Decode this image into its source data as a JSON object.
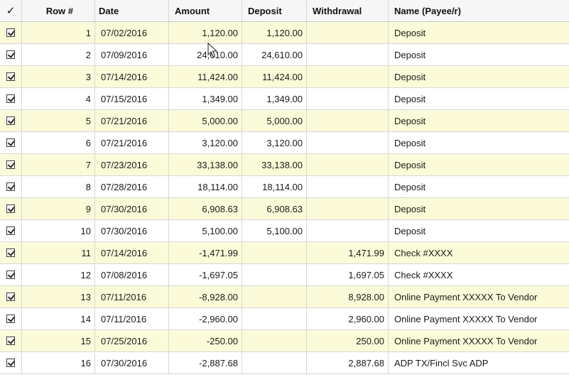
{
  "header": {
    "check": "✓",
    "row": "Row #",
    "date": "Date",
    "amount": "Amount",
    "deposit": "Deposit",
    "withdrawal": "Withdrawal",
    "name": "Name (Payee/r)"
  },
  "rows": [
    {
      "checked": true,
      "row": "1",
      "date": "07/02/2016",
      "amount": "1,120.00",
      "deposit": "1,120.00",
      "withdrawal": "",
      "name": "Deposit"
    },
    {
      "checked": true,
      "row": "2",
      "date": "07/09/2016",
      "amount": "24,610.00",
      "deposit": "24,610.00",
      "withdrawal": "",
      "name": "Deposit"
    },
    {
      "checked": true,
      "row": "3",
      "date": "07/14/2016",
      "amount": "11,424.00",
      "deposit": "11,424.00",
      "withdrawal": "",
      "name": "Deposit"
    },
    {
      "checked": true,
      "row": "4",
      "date": "07/15/2016",
      "amount": "1,349.00",
      "deposit": "1,349.00",
      "withdrawal": "",
      "name": "Deposit"
    },
    {
      "checked": true,
      "row": "5",
      "date": "07/21/2016",
      "amount": "5,000.00",
      "deposit": "5,000.00",
      "withdrawal": "",
      "name": "Deposit"
    },
    {
      "checked": true,
      "row": "6",
      "date": "07/21/2016",
      "amount": "3,120.00",
      "deposit": "3,120.00",
      "withdrawal": "",
      "name": "Deposit"
    },
    {
      "checked": true,
      "row": "7",
      "date": "07/23/2016",
      "amount": "33,138.00",
      "deposit": "33,138.00",
      "withdrawal": "",
      "name": "Deposit"
    },
    {
      "checked": true,
      "row": "8",
      "date": "07/28/2016",
      "amount": "18,114.00",
      "deposit": "18,114.00",
      "withdrawal": "",
      "name": "Deposit"
    },
    {
      "checked": true,
      "row": "9",
      "date": "07/30/2016",
      "amount": "6,908.63",
      "deposit": "6,908.63",
      "withdrawal": "",
      "name": "Deposit"
    },
    {
      "checked": true,
      "row": "10",
      "date": "07/30/2016",
      "amount": "5,100.00",
      "deposit": "5,100.00",
      "withdrawal": "",
      "name": "Deposit"
    },
    {
      "checked": true,
      "row": "11",
      "date": "07/14/2016",
      "amount": "-1,471.99",
      "deposit": "",
      "withdrawal": "1,471.99",
      "name": "Check #XXXX"
    },
    {
      "checked": true,
      "row": "12",
      "date": "07/08/2016",
      "amount": "-1,697.05",
      "deposit": "",
      "withdrawal": "1,697.05",
      "name": "Check #XXXX"
    },
    {
      "checked": true,
      "row": "13",
      "date": "07/11/2016",
      "amount": "-8,928.00",
      "deposit": "",
      "withdrawal": "8,928.00",
      "name": "Online Payment XXXXX To Vendor"
    },
    {
      "checked": true,
      "row": "14",
      "date": "07/11/2016",
      "amount": "-2,960.00",
      "deposit": "",
      "withdrawal": "2,960.00",
      "name": "Online Payment XXXXX To Vendor"
    },
    {
      "checked": true,
      "row": "15",
      "date": "07/25/2016",
      "amount": "-250.00",
      "deposit": "",
      "withdrawal": "250.00",
      "name": "Online Payment XXXXX To Vendor"
    },
    {
      "checked": true,
      "row": "16",
      "date": "07/30/2016",
      "amount": "-2,887.68",
      "deposit": "",
      "withdrawal": "2,887.68",
      "name": "ADP TX/Fincl Svc ADP"
    }
  ]
}
